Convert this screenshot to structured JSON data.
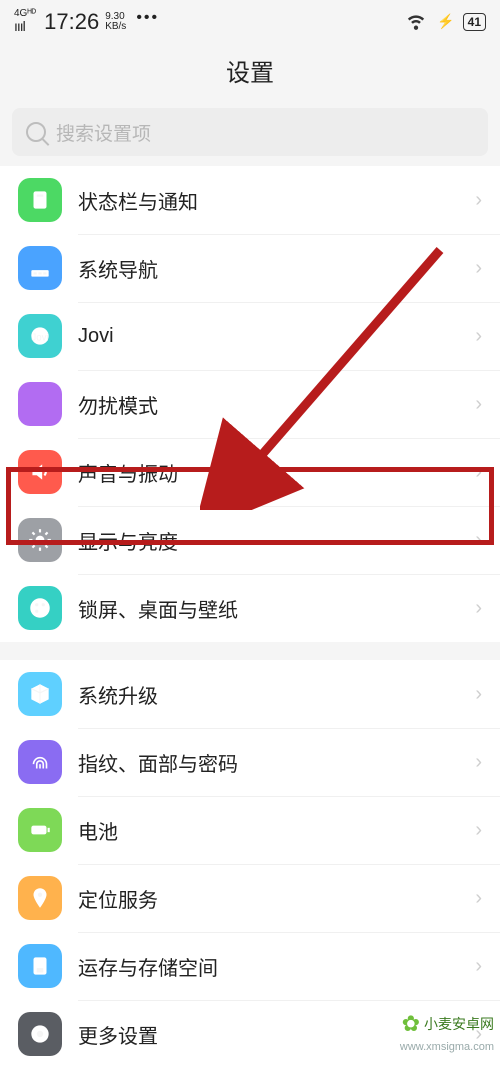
{
  "status": {
    "network": "4Gᴴᴰ",
    "signal": "ıııl",
    "time": "17:26",
    "speed_top": "9.30",
    "speed_bot": "KB/s",
    "dots": "•••",
    "battery": "41"
  },
  "header": {
    "title": "设置"
  },
  "search": {
    "placeholder": "搜索设置项"
  },
  "groups": [
    {
      "items": [
        {
          "key": "notif",
          "label": "状态栏与通知",
          "icon": "notification-icon",
          "cls": "bg-green"
        },
        {
          "key": "nav",
          "label": "系统导航",
          "icon": "navigation-icon",
          "cls": "bg-blue"
        },
        {
          "key": "jovi",
          "label": "Jovi",
          "icon": "jovi-icon",
          "cls": "bg-cyan"
        },
        {
          "key": "dnd",
          "label": "勿扰模式",
          "icon": "moon-icon",
          "cls": "bg-purple"
        },
        {
          "key": "sound",
          "label": "声音与振动",
          "icon": "speaker-icon",
          "cls": "bg-red"
        },
        {
          "key": "disp",
          "label": "显示与亮度",
          "icon": "brightness-icon",
          "cls": "bg-gray"
        },
        {
          "key": "wall",
          "label": "锁屏、桌面与壁纸",
          "icon": "palette-icon",
          "cls": "bg-teal"
        }
      ]
    },
    {
      "items": [
        {
          "key": "upd",
          "label": "系统升级",
          "icon": "cube-icon",
          "cls": "bg-cyan2"
        },
        {
          "key": "bio",
          "label": "指纹、面部与密码",
          "icon": "fingerprint-icon",
          "cls": "bg-violet"
        },
        {
          "key": "batt",
          "label": "电池",
          "icon": "battery-icon",
          "cls": "bg-lime"
        },
        {
          "key": "loc",
          "label": "定位服务",
          "icon": "location-icon",
          "cls": "bg-orange"
        },
        {
          "key": "stor",
          "label": "运存与存储空间",
          "icon": "storage-icon",
          "cls": "bg-sky"
        },
        {
          "key": "more",
          "label": "更多设置",
          "icon": "gear-icon",
          "cls": "bg-dark"
        }
      ]
    }
  ],
  "watermark": {
    "text": "小麦安卓网",
    "url": "www.xmsigma.com"
  },
  "chevron": "›"
}
